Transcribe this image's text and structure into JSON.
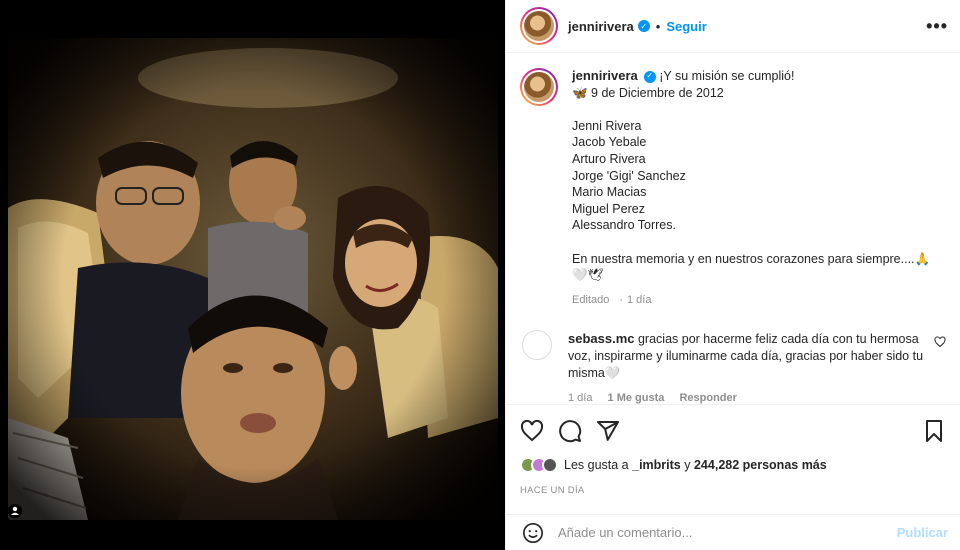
{
  "post": {
    "username": "jennirivera",
    "follow_label": "Seguir",
    "more_label": "•••"
  },
  "caption": {
    "username": "jennirivera",
    "text": "¡Y su misión se cumplió!",
    "date_line": "🦋 9 de Diciembre de 2012",
    "names": [
      "Jenni Rivera",
      "Jacob Yebale",
      "Arturo Rivera",
      "Jorge 'Gigi' Sanchez",
      "Mario Macias",
      "Miguel Perez",
      "Alessandro Torres."
    ],
    "closing": "En nuestra memoria y en nuestros corazones para siempre....🙏",
    "hearts": "🤍🕊",
    "edited": "Editado",
    "time": "1 día"
  },
  "comment": {
    "username": "sebass.mc",
    "text": "gracias por hacerme feliz cada día con tu hermosa voz, inspirarme y iluminarme cada día, gracias por haber sido tu misma🤍",
    "time": "1 día",
    "likes": "1 Me gusta",
    "reply": "Responder"
  },
  "likes": {
    "prefix": "Les gusta a",
    "user": "_imbrits",
    "middle": "y",
    "count": "244,282 personas más"
  },
  "posted_ago": "HACE UN DÍA",
  "add_comment": {
    "placeholder": "Añade un comentario...",
    "publish": "Publicar"
  },
  "colors": {
    "accent": "#0095f6",
    "publish_disabled": "#b2dffc",
    "muted": "#8e8e8e"
  }
}
